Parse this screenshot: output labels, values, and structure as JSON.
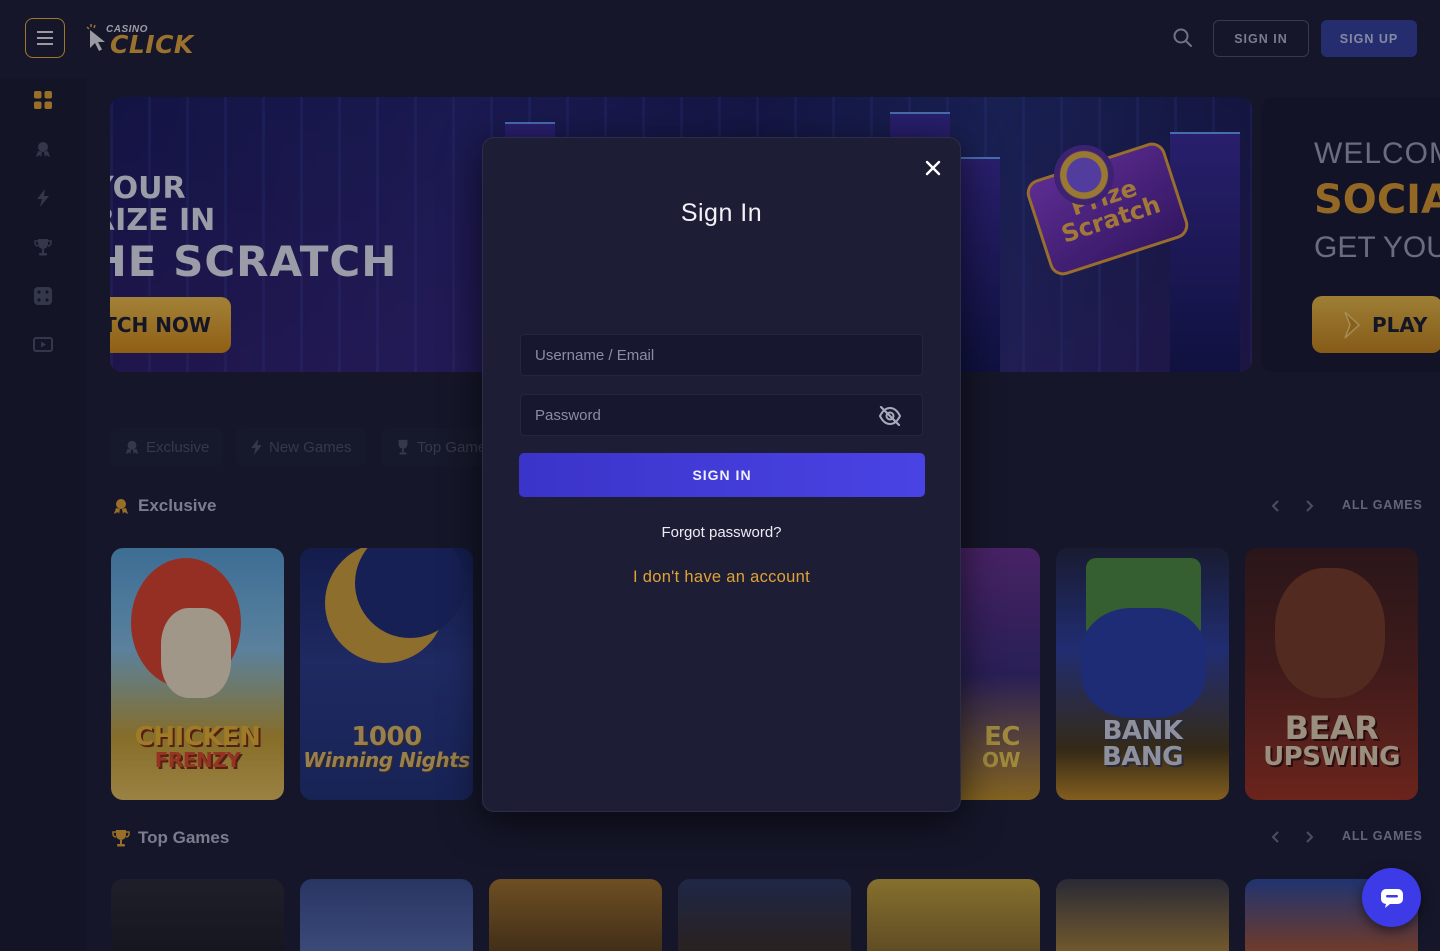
{
  "header": {
    "logo_small": "CASINO",
    "logo_big": "CLICK",
    "signin_label": "SIGN IN",
    "signup_label": "SIGN UP"
  },
  "sidebar": {
    "items": [
      {
        "icon": "grid-icon",
        "active": true
      },
      {
        "icon": "exclusive-icon"
      },
      {
        "icon": "lightning-icon"
      },
      {
        "icon": "trophy-icon"
      },
      {
        "icon": "dice-icon"
      },
      {
        "icon": "live-tv-icon"
      }
    ]
  },
  "banner": {
    "line1": "YOUR",
    "line2": "PRIZE IN",
    "line3": "THE SCRATCH",
    "button": "SCRATCH NOW",
    "badge_line1": "Prize",
    "badge_line2": "Scratch"
  },
  "banner2": {
    "line1": "WELCOME",
    "line2": "SOCIAL",
    "line3": "GET YOUR",
    "button": "PLAY"
  },
  "tabs": [
    {
      "label": "Exclusive"
    },
    {
      "label": "New Games"
    },
    {
      "label": "Top Games"
    }
  ],
  "sections": {
    "exclusive": {
      "title": "Exclusive",
      "all_label": "ALL GAMES"
    },
    "top": {
      "title": "Top Games",
      "all_label": "ALL GAMES"
    }
  },
  "games": [
    {
      "title_line1": "CHICKEN",
      "title_line2": "FRENZY"
    },
    {
      "title_line1": "1000",
      "title_line2": "Winning Nights"
    },
    {
      "title_line1": "EC",
      "title_line2": "OW"
    },
    {
      "title_line1": "BANK",
      "title_line2": "BANG"
    },
    {
      "title_line1": "BEAR",
      "title_line2": "UPSWING"
    }
  ],
  "modal": {
    "title": "Sign In",
    "username_placeholder": "Username / Email",
    "password_placeholder": "Password",
    "submit_label": "SIGN IN",
    "forgot_label": "Forgot password?",
    "no_account_label": "I don't have an account"
  },
  "colors": {
    "accent": "#f2b233",
    "primary": "#4a43e4",
    "background": "#1c1d33"
  }
}
